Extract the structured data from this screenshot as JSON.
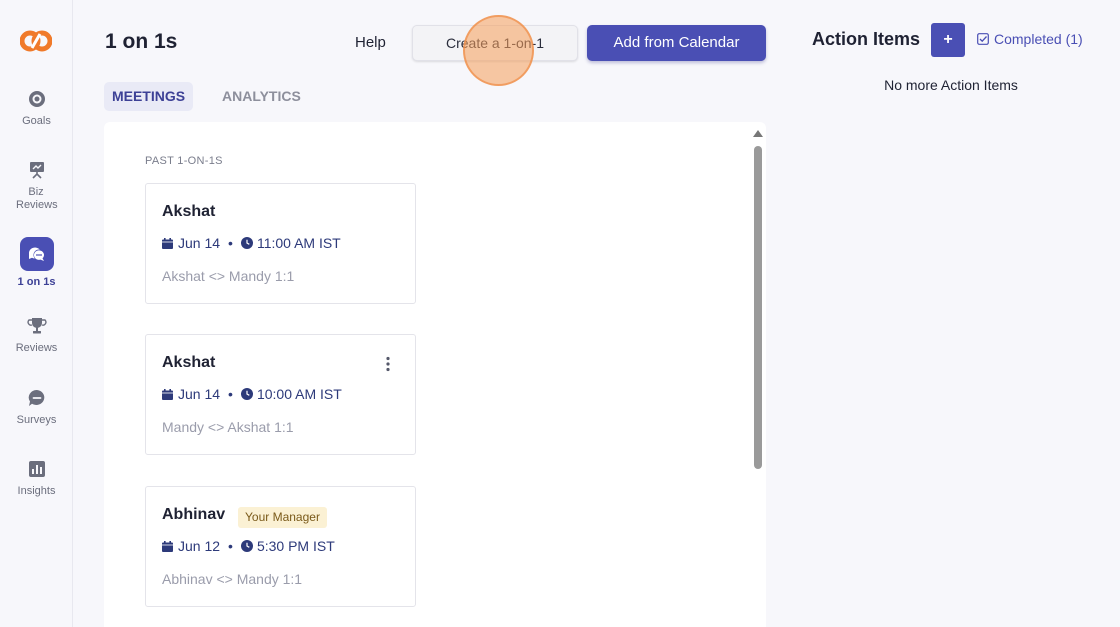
{
  "sidebar": {
    "items": [
      {
        "label": "Goals",
        "icon": "target-icon"
      },
      {
        "label": "Biz Reviews",
        "icon": "presentation-icon"
      },
      {
        "label": "1 on 1s",
        "icon": "chat-bubbles-icon",
        "active": true
      },
      {
        "label": "Reviews",
        "icon": "trophy-icon"
      },
      {
        "label": "Surveys",
        "icon": "survey-bubble-icon"
      },
      {
        "label": "Insights",
        "icon": "bar-chart-icon"
      }
    ]
  },
  "header": {
    "title": "1 on 1s",
    "help_label": "Help",
    "create_label": "Create a 1-on-1",
    "calendar_label": "Add from Calendar"
  },
  "tabs": [
    {
      "label": "MEETINGS",
      "active": true
    },
    {
      "label": "ANALYTICS",
      "active": false
    }
  ],
  "meetings": {
    "section_label": "PAST 1-ON-1S",
    "cards": [
      {
        "name": "Akshat",
        "date": "Jun 14",
        "time": "11:00 AM IST",
        "title": "Akshat <> Mandy 1:1"
      },
      {
        "name": "Akshat",
        "date": "Jun 14",
        "time": "10:00 AM IST",
        "title": "Mandy <> Akshat 1:1"
      },
      {
        "name": "Abhinav",
        "badge": "Your Manager",
        "date": "Jun 12",
        "time": "5:30 PM IST",
        "title": "Abhinav <> Mandy 1:1"
      }
    ]
  },
  "action_items": {
    "title": "Action Items",
    "add_label": "+",
    "completed_label": "Completed (1)",
    "empty_text": "No more Action Items"
  },
  "colors": {
    "brand": "#4a4fb4",
    "logo": "#f07a2a",
    "badge_bg": "#fbf1d4"
  }
}
